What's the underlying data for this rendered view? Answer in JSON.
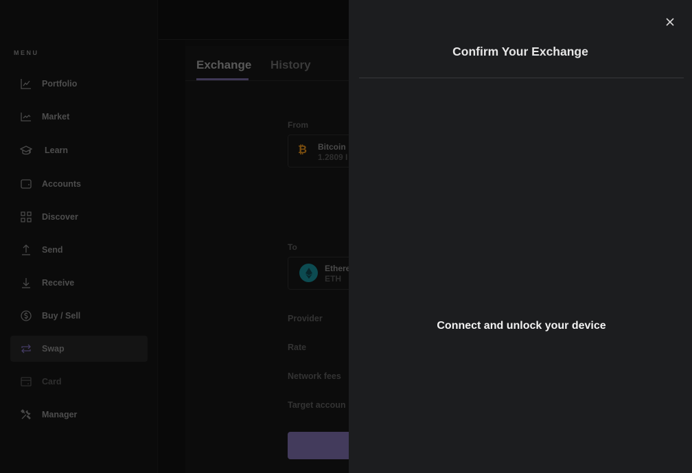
{
  "sidebar": {
    "menu_label": "MENU",
    "items": [
      {
        "label": "Portfolio",
        "icon": "chart-line-icon",
        "state": "normal"
      },
      {
        "label": "Market",
        "icon": "market-chart-icon",
        "state": "normal"
      },
      {
        "label": "Learn",
        "icon": "graduation-cap-icon",
        "state": "normal"
      },
      {
        "label": "Accounts",
        "icon": "wallet-icon",
        "state": "normal"
      },
      {
        "label": "Discover",
        "icon": "grid-icon",
        "state": "normal"
      },
      {
        "label": "Send",
        "icon": "arrow-up-icon",
        "state": "normal"
      },
      {
        "label": "Receive",
        "icon": "arrow-down-icon",
        "state": "normal"
      },
      {
        "label": "Buy / Sell",
        "icon": "dollar-circle-icon",
        "state": "normal"
      },
      {
        "label": "Swap",
        "icon": "swap-arrows-icon",
        "state": "active"
      },
      {
        "label": "Card",
        "icon": "card-icon",
        "state": "disabled"
      },
      {
        "label": "Manager",
        "icon": "tools-icon",
        "state": "normal"
      }
    ]
  },
  "main": {
    "tabs": [
      {
        "label": "Exchange",
        "active": true
      },
      {
        "label": "History",
        "active": false
      }
    ],
    "from": {
      "label": "From",
      "asset_name": "Bitcoin",
      "asset_balance": "1.2809 I",
      "icon": "bitcoin-icon",
      "icon_glyph": "₿"
    },
    "to": {
      "label": "To",
      "asset_name": "Ethere",
      "asset_ticker": "ETH",
      "icon": "ethereum-icon"
    },
    "details": {
      "provider_label": "Provider",
      "rate_label": "Rate",
      "network_fees_label": "Network fees",
      "target_account_label": "Target accoun"
    }
  },
  "drawer": {
    "title": "Confirm Your Exchange",
    "message": "Connect and unlock your device",
    "close_icon": "close-icon"
  },
  "colors": {
    "accent": "#433b5c",
    "drawer_bg": "#1c1d1f",
    "bitcoin": "#7a4d0e",
    "ethereum": "#0c4b51"
  }
}
